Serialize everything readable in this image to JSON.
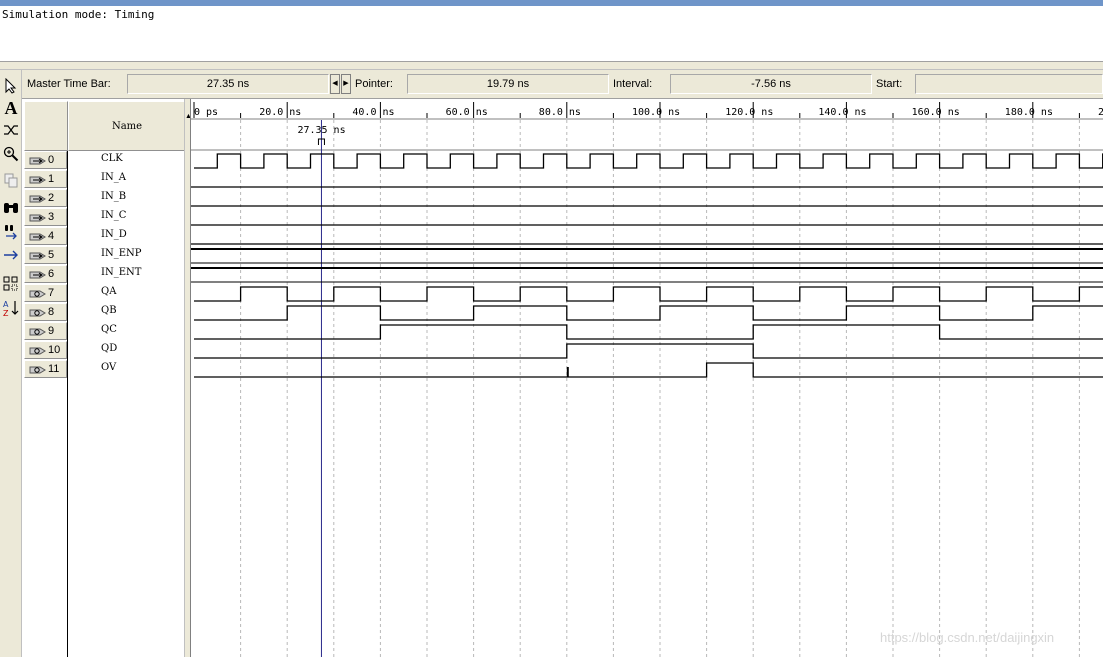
{
  "mode": {
    "text": "Simulation mode: Timing"
  },
  "timebar": {
    "master_label": "Master Time Bar:",
    "master_value": "27.35 ns",
    "pointer_label": "Pointer:",
    "pointer_value": "19.79 ns",
    "interval_label": "Interval:",
    "interval_value": "-7.56 ns",
    "start_label": "Start:",
    "start_value": ""
  },
  "table": {
    "name_header": "Name"
  },
  "signals": [
    {
      "idx": "0",
      "name": "CLK",
      "type": "input"
    },
    {
      "idx": "1",
      "name": "IN_A",
      "type": "input"
    },
    {
      "idx": "2",
      "name": "IN_B",
      "type": "input"
    },
    {
      "idx": "3",
      "name": "IN_C",
      "type": "input"
    },
    {
      "idx": "4",
      "name": "IN_D",
      "type": "input"
    },
    {
      "idx": "5",
      "name": "IN_ENP",
      "type": "input"
    },
    {
      "idx": "6",
      "name": "IN_ENT",
      "type": "input"
    },
    {
      "idx": "7",
      "name": "QA",
      "type": "output"
    },
    {
      "idx": "8",
      "name": "QB",
      "type": "output"
    },
    {
      "idx": "9",
      "name": "QC",
      "type": "output"
    },
    {
      "idx": "10",
      "name": "QD",
      "type": "output"
    },
    {
      "idx": "11",
      "name": "OV",
      "type": "output"
    }
  ],
  "timeline": {
    "ticks": [
      "0 ps",
      "20.0 ns",
      "40.0 ns",
      "60.0 ns",
      "80.0 ns",
      "100.0 ns",
      "120.0 ns",
      "140.0 ns",
      "160.0 ns",
      "180.0 ns",
      "2"
    ],
    "cursor_label": "27.35 ns",
    "cursor_ns": 27.35
  },
  "waves": {
    "CLK": {
      "kind": "clock",
      "period_ns": 10,
      "high_ns": 5
    },
    "IN_A": {
      "kind": "low"
    },
    "IN_B": {
      "kind": "low"
    },
    "IN_C": {
      "kind": "low"
    },
    "IN_D": {
      "kind": "low"
    },
    "IN_ENP": {
      "kind": "high"
    },
    "IN_ENT": {
      "kind": "high"
    },
    "QA": {
      "kind": "edges",
      "start": 0,
      "edges_ns": [
        10,
        20,
        30,
        40,
        50,
        60,
        70,
        80,
        90,
        100,
        110,
        120,
        130,
        140,
        150,
        160,
        170,
        180,
        190,
        200
      ]
    },
    "QB": {
      "kind": "edges",
      "start": 0,
      "edges_ns": [
        20,
        40,
        60,
        80,
        100,
        120,
        140,
        160,
        180,
        200
      ]
    },
    "QC": {
      "kind": "edges",
      "start": 0,
      "edges_ns": [
        40,
        80,
        120,
        160,
        200
      ]
    },
    "QD": {
      "kind": "edges",
      "start": 0,
      "edges_ns": [
        80,
        120
      ]
    },
    "OV": {
      "kind": "edges",
      "start": 0,
      "edges_ns": [
        110,
        120
      ],
      "glitch_ns": 80
    }
  },
  "colors": {
    "cursor": "#2a2a8a",
    "grid": "#b8b8b8",
    "wave": "#000000"
  },
  "icons": [
    "pointer-icon",
    "text-tool-icon",
    "waveform-editing-icon",
    "zoom-icon",
    "copy-icon",
    "find-icon",
    "replace-icon",
    "arrow-icon",
    "grid-icon",
    "sort-icon"
  ],
  "watermark": "https://blog.csdn.net/daijingxin"
}
